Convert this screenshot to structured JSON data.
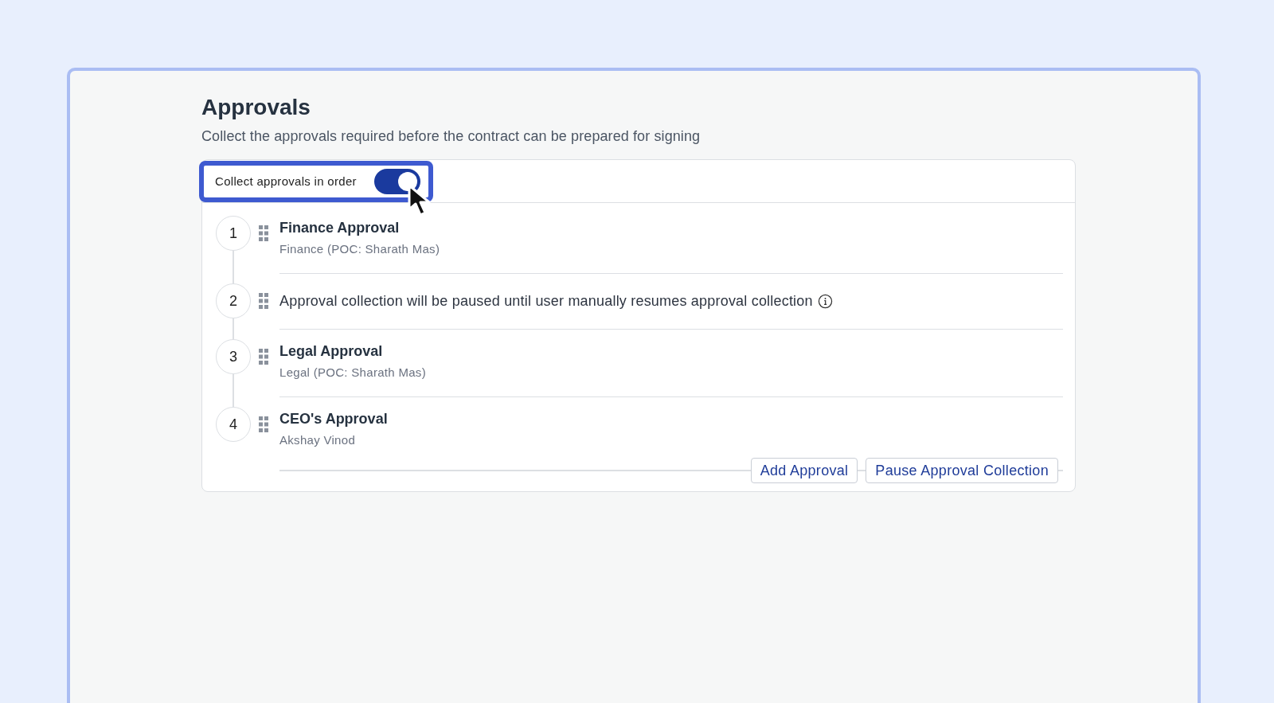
{
  "header": {
    "title": "Approvals",
    "subtitle": "Collect the approvals required before the contract can be prepared for signing"
  },
  "order_toggle": {
    "label": "Collect approvals in order",
    "on": true,
    "focused": true
  },
  "steps": [
    {
      "kind": "approval",
      "number": "1",
      "title": "Finance Approval",
      "detail": "Finance (POC: Sharath Mas)"
    },
    {
      "kind": "pause",
      "number": "2",
      "text": "Approval collection will be paused until user manually resumes approval collection"
    },
    {
      "kind": "approval",
      "number": "3",
      "title": "Legal Approval",
      "detail": "Legal (POC: Sharath Mas)"
    },
    {
      "kind": "approval",
      "number": "4",
      "title": "CEO's Approval",
      "detail": "Akshay Vinod"
    }
  ],
  "buttons": [
    "Add Approval",
    "Pause Approval Collection"
  ]
}
